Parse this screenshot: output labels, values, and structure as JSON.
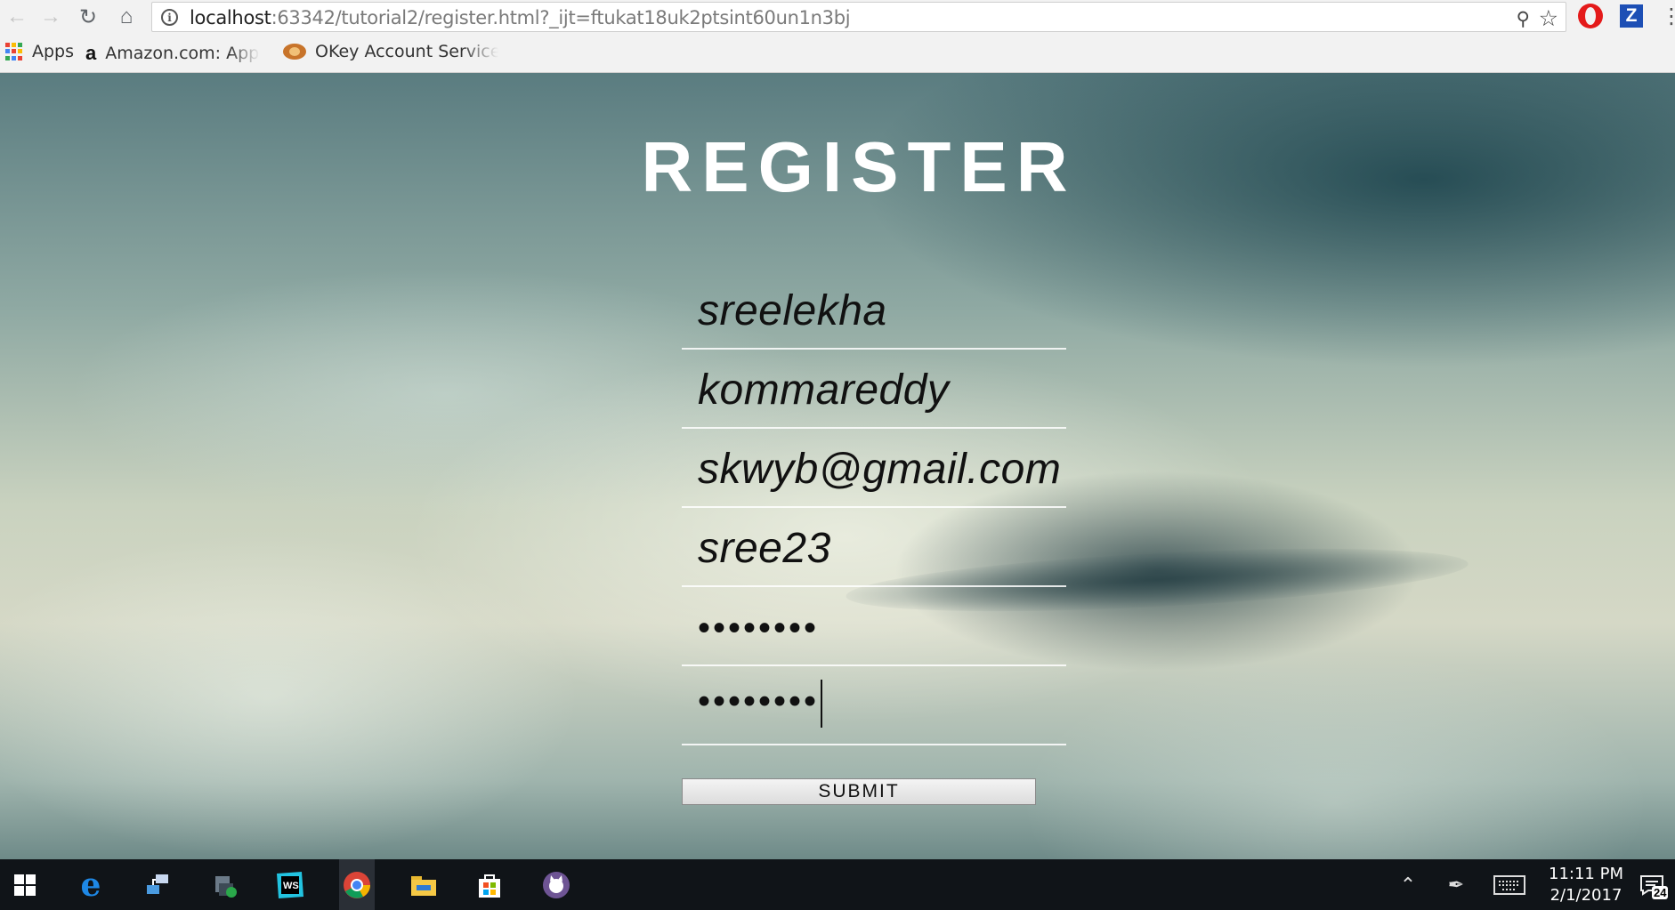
{
  "browser": {
    "url_host": "localhost",
    "url_path": ":63342/tutorial2/register.html?_ijt=ftukat18uk2ptsint60un1n3bj",
    "bookmarks": [
      {
        "label": "Apps",
        "icon": "apps-grid-icon"
      },
      {
        "label": "Amazon.com: Apple iP",
        "icon": "amazon-icon"
      },
      {
        "label": "OKey Account Service",
        "icon": "okey-icon"
      }
    ],
    "extension_z_label": "Z"
  },
  "page": {
    "title": "REGISTER",
    "fields": [
      {
        "name": "first-name-field",
        "value": "sreelekha"
      },
      {
        "name": "last-name-field",
        "value": "kommareddy"
      },
      {
        "name": "email-field",
        "value": "skwyb@gmail.com"
      },
      {
        "name": "username-field",
        "value": "sree23"
      },
      {
        "name": "password-field",
        "value": "••••••••"
      },
      {
        "name": "confirm-password-field",
        "value": "••••••••"
      }
    ],
    "submit_label": "SUBMIT"
  },
  "taskbar": {
    "time": "11:11 PM",
    "date": "2/1/2017",
    "notification_count": "24"
  },
  "colors": {
    "title_text": "#ffffff",
    "field_text": "#111111",
    "taskbar_bg": "#101418"
  }
}
